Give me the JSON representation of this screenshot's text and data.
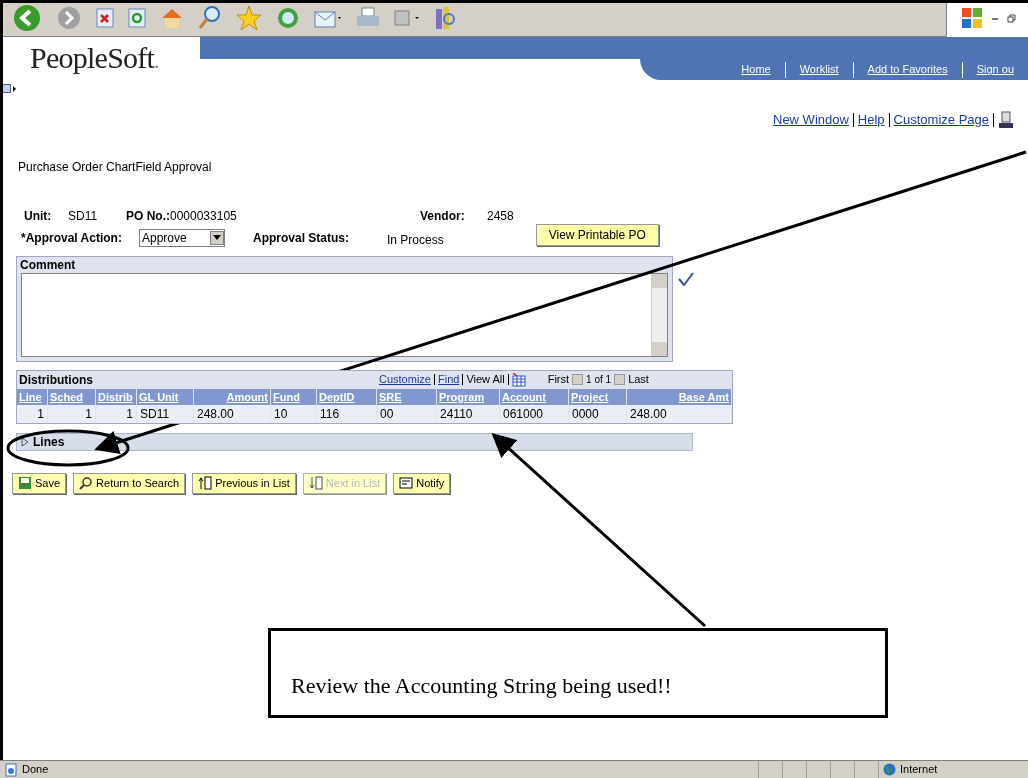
{
  "status_bar": {
    "text": "Done",
    "zone": "Internet"
  },
  "header": {
    "logo": "PeopleSoft",
    "logo_mark": ".",
    "nav": [
      "Home",
      "Worklist",
      "Add to Favorites",
      "Sign ou"
    ]
  },
  "page_links": [
    "New Window",
    "Help",
    "Customize Page"
  ],
  "page_title": "Purchase Order ChartField Approval",
  "fields": {
    "unit_label": "Unit:",
    "unit": "SD11",
    "po_label": "PO No.:",
    "po": "0000033105",
    "vendor_label": "Vendor:",
    "vendor": "2458",
    "action_label": "*Approval Action:",
    "action": "Approve",
    "status_label": "Approval Status:",
    "status": "In Process",
    "print_button": "View Printable PO"
  },
  "comment": {
    "label": "Comment"
  },
  "distributions": {
    "title": "Distributions",
    "links": [
      "Customize",
      "Find"
    ],
    "view_all": "View All",
    "first": "First",
    "range": "1 of 1",
    "last": "Last",
    "columns": [
      "Line",
      "Sched",
      "Distrib",
      "GL Unit",
      "Amount",
      "Fund",
      "DeptID",
      "SRE",
      "Program",
      "Account",
      "Project",
      "Base Amt"
    ],
    "rows": [
      [
        "1",
        "1",
        "1",
        "SD11",
        "248.00",
        "10",
        "116",
        "00",
        "24110",
        "061000",
        "0000",
        "248.00"
      ]
    ]
  },
  "lines": {
    "label": "Lines",
    "expanded": false
  },
  "buttons": [
    {
      "label": "Save",
      "disabled": false
    },
    {
      "label": "Return to Search",
      "disabled": false
    },
    {
      "label": "Previous in List",
      "disabled": false
    },
    {
      "label": "Next in List",
      "disabled": true
    },
    {
      "label": "Notify",
      "disabled": false
    }
  ],
  "callout": "Review the Accounting String being used!!"
}
